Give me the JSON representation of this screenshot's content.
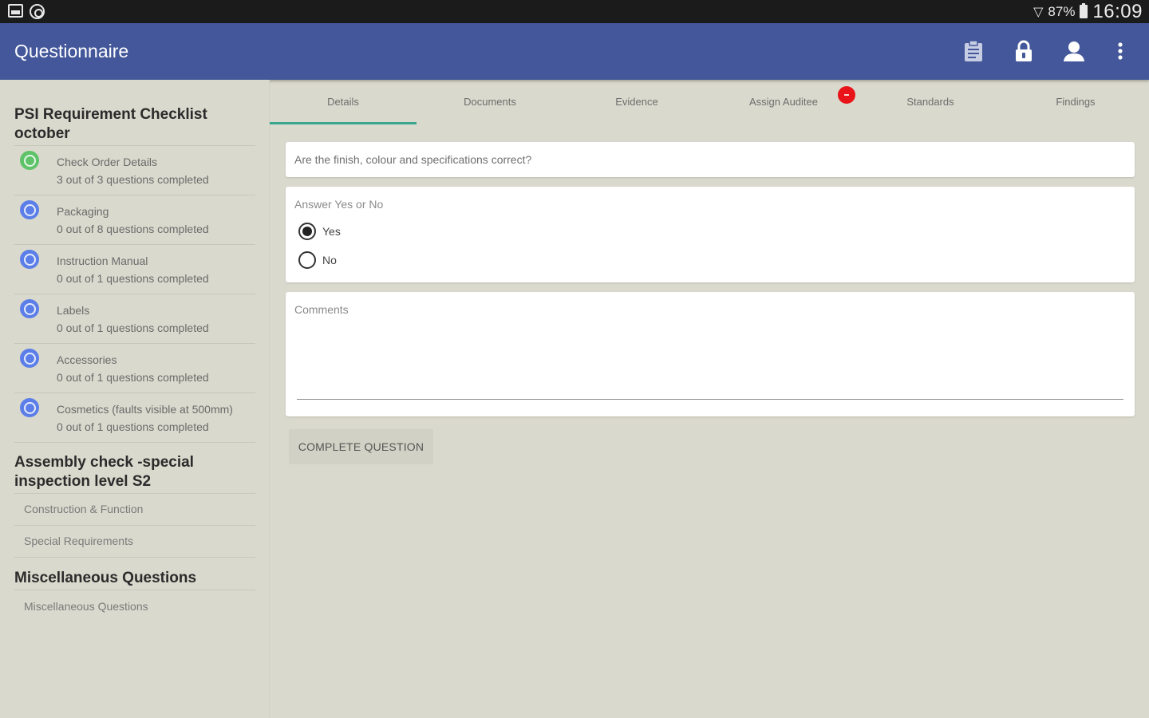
{
  "status_bar": {
    "battery_percent": "87%",
    "time": "16:09"
  },
  "app_bar": {
    "title": "Questionnaire",
    "icons": [
      "clipboard-icon",
      "lock-icon",
      "person-icon",
      "more-vert-icon"
    ]
  },
  "sidebar": {
    "sections": [
      {
        "title": "PSI Requirement Checklist october",
        "items": [
          {
            "name": "Check Order Details",
            "progress": "3 out of 3 questions completed",
            "status": "complete",
            "color": "#5fc36a"
          },
          {
            "name": "Packaging",
            "progress": "0 out of 8 questions completed",
            "status": "incomplete",
            "color": "#5b7ee8"
          },
          {
            "name": "Instruction Manual",
            "progress": "0 out of 1 questions completed",
            "status": "incomplete",
            "color": "#5b7ee8"
          },
          {
            "name": "Labels",
            "progress": "0 out of 1 questions completed",
            "status": "incomplete",
            "color": "#5b7ee8"
          },
          {
            "name": "Accessories",
            "progress": "0 out of 1 questions completed",
            "status": "incomplete",
            "color": "#5b7ee8"
          },
          {
            "name": "Cosmetics (faults visible at 500mm)",
            "progress": "0 out of 1 questions completed",
            "status": "incomplete",
            "color": "#5b7ee8"
          }
        ]
      },
      {
        "title": "Assembly check -special inspection level S2",
        "items": [
          {
            "name": "Construction & Function"
          },
          {
            "name": "Special Requirements"
          }
        ]
      },
      {
        "title": "Miscellaneous Questions",
        "items": [
          {
            "name": "Miscellaneous Questions"
          }
        ]
      }
    ]
  },
  "tabs": [
    {
      "label": "Details",
      "active": true
    },
    {
      "label": "Documents"
    },
    {
      "label": "Evidence"
    },
    {
      "label": "Assign Auditee",
      "badge": true
    },
    {
      "label": "Standards"
    },
    {
      "label": "Findings"
    }
  ],
  "main": {
    "question": "Are the finish, colour and specifications correct?",
    "answer_label": "Answer Yes or No",
    "options": [
      {
        "label": "Yes",
        "selected": true
      },
      {
        "label": "No",
        "selected": false
      }
    ],
    "comments_label": "Comments",
    "complete_button": "COMPLETE QUESTION"
  },
  "colors": {
    "app_bar": "#43579a",
    "background": "#dad9cd",
    "tab_indicator": "#3aa891",
    "badge": "#e8141a"
  }
}
